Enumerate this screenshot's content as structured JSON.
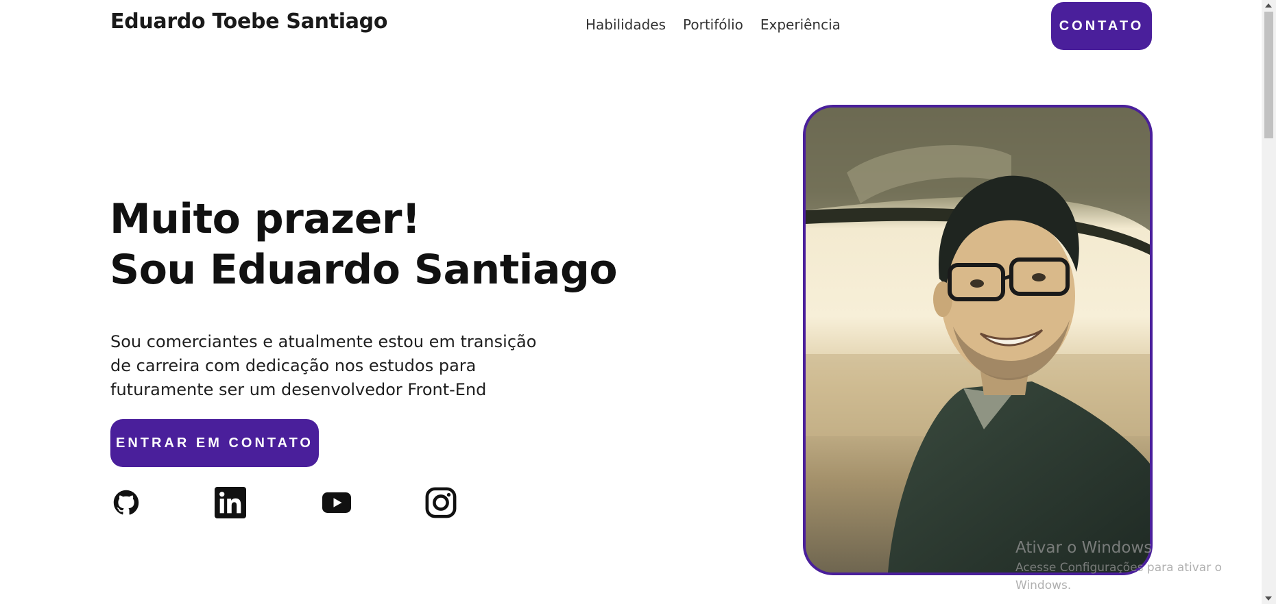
{
  "header": {
    "brand": "Eduardo Toebe Santiago",
    "nav": [
      "Habilidades",
      "Portifólio",
      "Experiência"
    ],
    "contact_button": "CONTATO"
  },
  "hero": {
    "title_line1": "Muito prazer!",
    "title_line2": "Sou Eduardo Santiago",
    "description": "Sou comerciantes e atualmente estou em transição de carreira com dedicação nos estudos para futuramente ser um desenvolvedor Front-End",
    "cta_button": "ENTRAR EM CONTATO"
  },
  "socials": [
    {
      "icon": "github-icon"
    },
    {
      "icon": "linkedin-icon"
    },
    {
      "icon": "youtube-icon"
    },
    {
      "icon": "instagram-icon"
    }
  ],
  "colors": {
    "accent": "#4a1f9b",
    "text": "#111111",
    "background": "#ffffff"
  },
  "windows_watermark": {
    "line1": "Ativar o Windows",
    "line2": "Acesse Configurações para ativar o Windows."
  }
}
